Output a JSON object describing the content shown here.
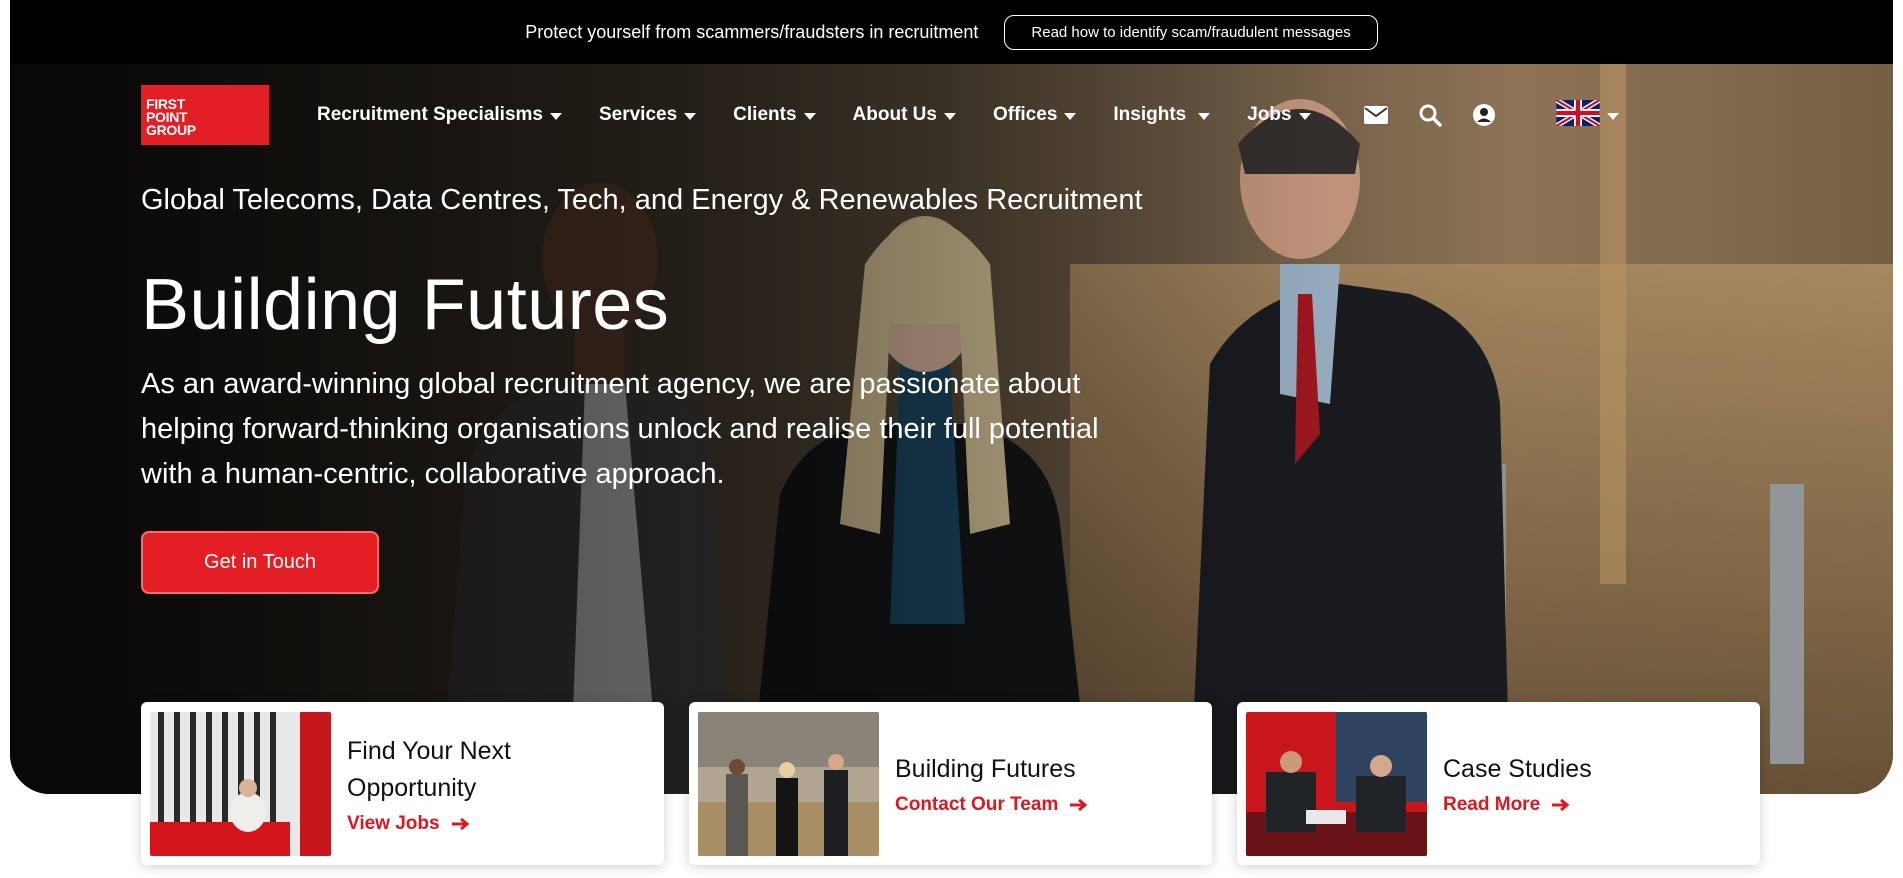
{
  "alert": {
    "text": "Protect yourself from scammers/fraudsters in recruitment",
    "button_label": "Read how to identify scam/fraudulent messages"
  },
  "logo": {
    "line1": "FIRST",
    "line2": "POINT",
    "line3": "GROUP"
  },
  "nav": {
    "items": [
      {
        "label": "Recruitment Specialisms"
      },
      {
        "label": "Services"
      },
      {
        "label": "Clients"
      },
      {
        "label": "About Us"
      },
      {
        "label": "Offices"
      },
      {
        "label": "Insights"
      },
      {
        "label": "Jobs"
      }
    ],
    "icons": [
      "envelope-icon",
      "search-icon",
      "user-account-icon",
      "uk-flag-icon"
    ]
  },
  "hero": {
    "tagline": "Global Telecoms, Data Centres, Tech, and Energy & Renewables Recruitment",
    "headline": "Building Futures",
    "intro": "As an award-winning global recruitment agency, we are passionate about helping forward-thinking organisations unlock and realise their full potential with a human-centric, collaborative approach.",
    "cta_label": "Get in Touch"
  },
  "cards": [
    {
      "title": "Find Your Next Opportunity",
      "link": "View Jobs"
    },
    {
      "title": "Building Futures",
      "link": "Contact Our Team"
    },
    {
      "title": "Case Studies",
      "link": "Read More"
    }
  ],
  "colors": {
    "brand_red": "#e31e24",
    "link_red": "#d81920",
    "bar_black": "#000000"
  }
}
